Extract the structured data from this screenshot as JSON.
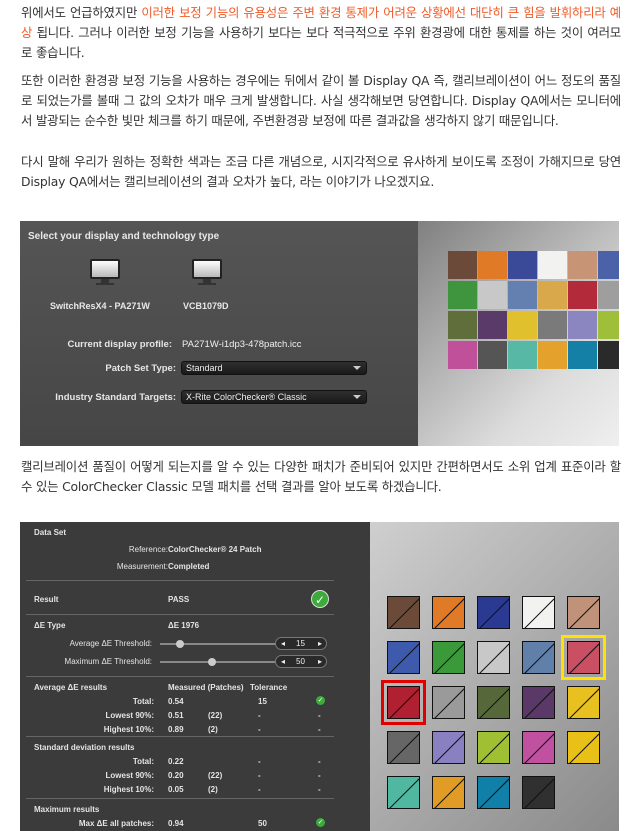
{
  "paragraphs": {
    "p1_a": "위에서도 언급하였지만 ",
    "p1_hl": "이러한 보정 기능의 유용성은 주변 환경 통제가 어려운 상황에선 대단히 큰 힘을 발휘하리라 예상",
    "p1_b": " 됩니다. 그러나 이러한 보정 기능을 사용하기 보다는 보다 적극적으로 주위 환경광에 대한 통제를 하는 것이 여러모로 좋습니다.",
    "p2": "또한 이러한 환경광 보정 기능을 사용하는 경우에는 뒤에서 같이 볼 Display QA 즉, 캘리브레이션이 어느 정도의 품질로 되었는가를 볼때 그 값의 오차가 매우 크게 발생합니다. 사실 생각해보면 당연합니다. Display QA에서는 모니터에서 발광되는 순수한 빛만 체크를 하기 때문에, 주변환경광 보정에 따른 결과값을 생각하지 않기 때문입니다.",
    "p3": "다시 말해 우리가 원하는 정확한 색과는 조금 다른 개념으로, 시지각적으로 유사하게 보이도록 조정이 가해지므로 당연 Display QA에서는 캘리브레이션의 결과 오차가 높다, 라는 이야기가 나오겠지요.",
    "p4": "캘리브레이션 품질이 어떻게 되는지를 알 수 있는 다양한 패치가 준비되어 있지만 간편하면서도 소위 업계 표준이라 할 수 있는 ColorChecker Classic 모델 패치를 선택 결과를 알아 보도록 하겠습니다."
  },
  "shot1": {
    "title": "Select your display and technology type",
    "display1": "SwitchResX4 - PA271W",
    "display2": "VCB1079D",
    "profile_label": "Current display profile:",
    "profile_value": "PA271W-i1dp3-478patch.icc",
    "patchset_label": "Patch Set Type:",
    "patchset_value": "Standard",
    "targets_label": "Industry Standard Targets:",
    "targets_value": "X-Rite ColorChecker® Classic"
  },
  "shot2": {
    "dataset": "Data Set",
    "reference_label": "Reference:",
    "reference_value": "ColorChecker® 24 Patch",
    "measurement_label": "Measurement:",
    "measurement_value": "Completed",
    "result_label": "Result",
    "result_value": "PASS",
    "de_type_label": "ΔE Type",
    "de_type_value": "ΔE 1976",
    "avg_thresh_label": "Average  ΔE Threshold:",
    "avg_thresh_value": "15",
    "max_thresh_label": "Maximum  ΔE Threshold:",
    "max_thresh_value": "50",
    "avg_results_label": "Average ΔE results",
    "col_measured": "Measured (Patches)",
    "col_tolerance": "Tolerance",
    "avg_rows": [
      {
        "label": "Total:",
        "value": "0.54",
        "patches": "",
        "tol": "15",
        "mark": "check"
      },
      {
        "label": "Lowest 90%:",
        "value": "0.51",
        "patches": "(22)",
        "tol": "-",
        "mark": "-"
      },
      {
        "label": "Highest 10%:",
        "value": "0.89",
        "patches": "(2)",
        "tol": "-",
        "mark": "-"
      }
    ],
    "std_label": "Standard deviation results",
    "std_rows": [
      {
        "label": "Total:",
        "value": "0.22",
        "patches": "",
        "tol": "-",
        "mark": "-"
      },
      {
        "label": "Lowest 90%:",
        "value": "0.20",
        "patches": "(22)",
        "tol": "-",
        "mark": "-"
      },
      {
        "label": "Highest 10%:",
        "value": "0.05",
        "patches": "(2)",
        "tol": "-",
        "mark": "-"
      }
    ],
    "max_label": "Maximum results",
    "max_rows": [
      {
        "label": "Max ΔE all patches:",
        "value": "0.94",
        "patches": "",
        "tol": "50",
        "mark": "check"
      }
    ]
  },
  "colors": {
    "highlight": "#f05a28",
    "checker1": [
      "#6b4a3a",
      "#e07a26",
      "#3a4a98",
      "#f2f2f0",
      "#c89476",
      "#4c62a8",
      "#3f953e",
      "#c8c8c8",
      "#6380b0",
      "#d9a84a",
      "#b32a3a",
      "#9e9e9e",
      "#5f6e3a",
      "#5a3a68",
      "#e0c02c",
      "#7a7a7a",
      "#8b86c0",
      "#9fbf3a",
      "#c0509a",
      "#555555",
      "#58b8a6",
      "#e4a22c",
      "#1480a6",
      "#2a2a2a"
    ],
    "checker2": [
      "#6b4a3a",
      "#e07a26",
      "#2a3a92",
      "#f2f2f0",
      "#c0927a",
      "#3e5aac",
      "#3a9a3a",
      "#c8c8c8",
      "#6080aa",
      "#c85062",
      "#b02030",
      "#9a9a9a",
      "#56683a",
      "#5a3868",
      "#e8c020",
      "#666666",
      "#8880c0",
      "#a0c034",
      "#c050a0",
      "#e8c018",
      "#50b8a0",
      "#e09c24",
      "#1080a8",
      "#303030"
    ]
  }
}
